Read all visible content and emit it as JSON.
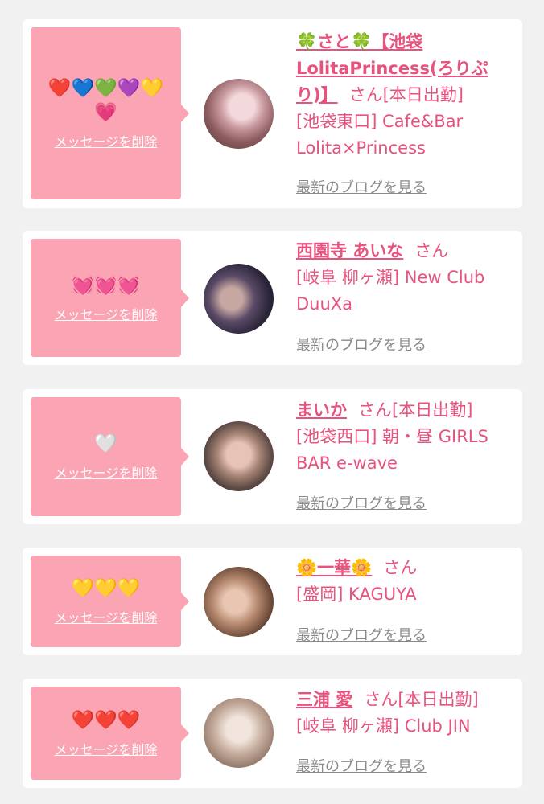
{
  "messages": [
    {
      "emoji": "❤️💙💚💜💛💗",
      "delete_label": "メッセージを削除",
      "name": "🍀さと🍀【池袋LolitaPrincess(ろりぷり)】",
      "honorific": "さん",
      "status": "[本日出勤]",
      "shop": "[池袋東口] Cafe&Bar Lolita×Princess",
      "blog_label": "最新のブログを見る"
    },
    {
      "emoji": "💓💓💓",
      "delete_label": "メッセージを削除",
      "name": "西園寺 あいな",
      "honorific": "さん",
      "status": "",
      "shop": "[岐阜 柳ヶ瀬] New Club DuuXa",
      "blog_label": "最新のブログを見る"
    },
    {
      "emoji": "🤍",
      "delete_label": "メッセージを削除",
      "name": "まいか",
      "honorific": "さん",
      "status": "[本日出勤]",
      "shop": "[池袋西口] 朝・昼 GIRLS BAR e-wave",
      "blog_label": "最新のブログを見る"
    },
    {
      "emoji": "💛💛💛",
      "delete_label": "メッセージを削除",
      "name": "🌼一華🌼",
      "honorific": "さん",
      "status": "",
      "shop": "[盛岡] KAGUYA",
      "blog_label": "最新のブログを見る"
    },
    {
      "emoji": "❤️❤️❤️",
      "delete_label": "メッセージを削除",
      "name": "三浦 愛",
      "honorific": "さん",
      "status": "[本日出勤]",
      "shop": "[岐阜 柳ヶ瀬] Club JIN",
      "blog_label": "最新のブログを見る"
    }
  ],
  "colors": {
    "page_bg": "#f1f1f1",
    "card_bg": "#ffffff",
    "bubble_bg": "#fba4b4",
    "accent_text": "#e7537d",
    "muted_link": "#8a8a8a"
  }
}
